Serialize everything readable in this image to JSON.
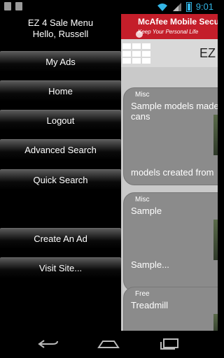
{
  "status_bar": {
    "time": "9:01",
    "icons": [
      "notification-icon",
      "notification-icon",
      "wifi-icon",
      "signal-icon",
      "battery-icon"
    ]
  },
  "drawer": {
    "title": "EZ 4 Sale Menu",
    "greeting": "Hello, Russell",
    "items": [
      {
        "label": "My Ads"
      },
      {
        "label": "Home"
      },
      {
        "label": "Logout"
      },
      {
        "label": "Advanced Search"
      },
      {
        "label": "Quick Search"
      },
      {
        "label": "Create An Ad"
      },
      {
        "label": "Visit Site..."
      }
    ]
  },
  "ad_banner": {
    "title": "McAfee Mobile Secu",
    "subtitle": "Keep Your Personal Life"
  },
  "toolbar": {
    "app_title": "EZ"
  },
  "listings": [
    {
      "category": "Misc",
      "title": "Sample models made cans",
      "snippet": "models created from"
    },
    {
      "category": "Misc",
      "title": "Sample",
      "snippet": "Sample..."
    },
    {
      "category": "Free",
      "title": "Treadmill",
      "snippet": ""
    }
  ],
  "nav_bar": {
    "icons": [
      "back-icon",
      "home-icon",
      "recent-apps-icon"
    ]
  },
  "colors": {
    "status_accent": "#33b5e5",
    "ad_red": "#c41e2a",
    "card_gray": "#8b8b8b",
    "content_bg": "#c9c9c9"
  }
}
